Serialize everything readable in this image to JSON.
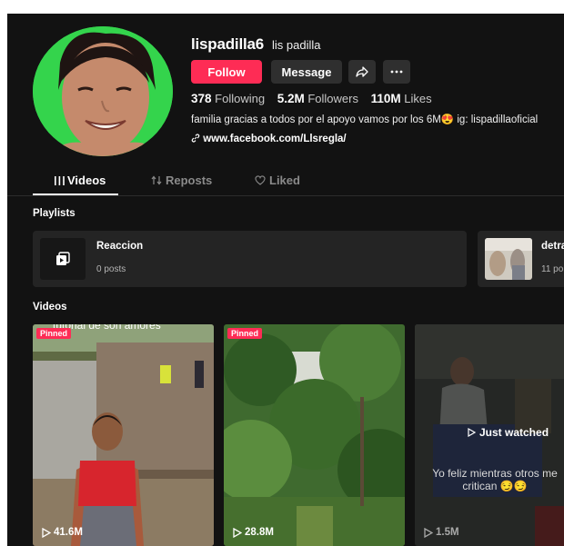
{
  "profile": {
    "username": "lispadilla6",
    "nickname": "lis padilla",
    "follow_label": "Follow",
    "message_label": "Message",
    "stats": {
      "following_count": "378",
      "following_label": "Following",
      "followers_count": "5.2M",
      "followers_label": "Followers",
      "likes_count": "110M",
      "likes_label": "Likes"
    },
    "bio": "familia gracias a todos por el apoyo vamos por los 6M😍 ig: lispadillaoficial",
    "link": "www.facebook.com/Llsregla/"
  },
  "tabs": [
    {
      "label": "Videos",
      "icon": "grid-icon",
      "active": true
    },
    {
      "label": "Reposts",
      "icon": "repost-icon",
      "active": false
    },
    {
      "label": "Liked",
      "icon": "heart-outline-icon",
      "active": false
    }
  ],
  "playlists_section": {
    "title": "Playlists",
    "items": [
      {
        "name": "Reaccion",
        "posts": "0 posts"
      },
      {
        "name": "detra",
        "posts": "11 po"
      }
    ]
  },
  "videos_section": {
    "title": "Videos",
    "items": [
      {
        "pinned_label": "Pinned",
        "views": "41.6M",
        "overlay_text": "tutorial de son amores"
      },
      {
        "pinned_label": "Pinned",
        "views": "28.8M"
      },
      {
        "views": "1.5M",
        "badge": "Just watched",
        "caption": "Yo feliz mientras otros me critican 😏😏"
      }
    ]
  },
  "colors": {
    "accent": "#fe2c55",
    "background": "#121212",
    "panel": "#242424",
    "button": "#2f2f2f"
  }
}
